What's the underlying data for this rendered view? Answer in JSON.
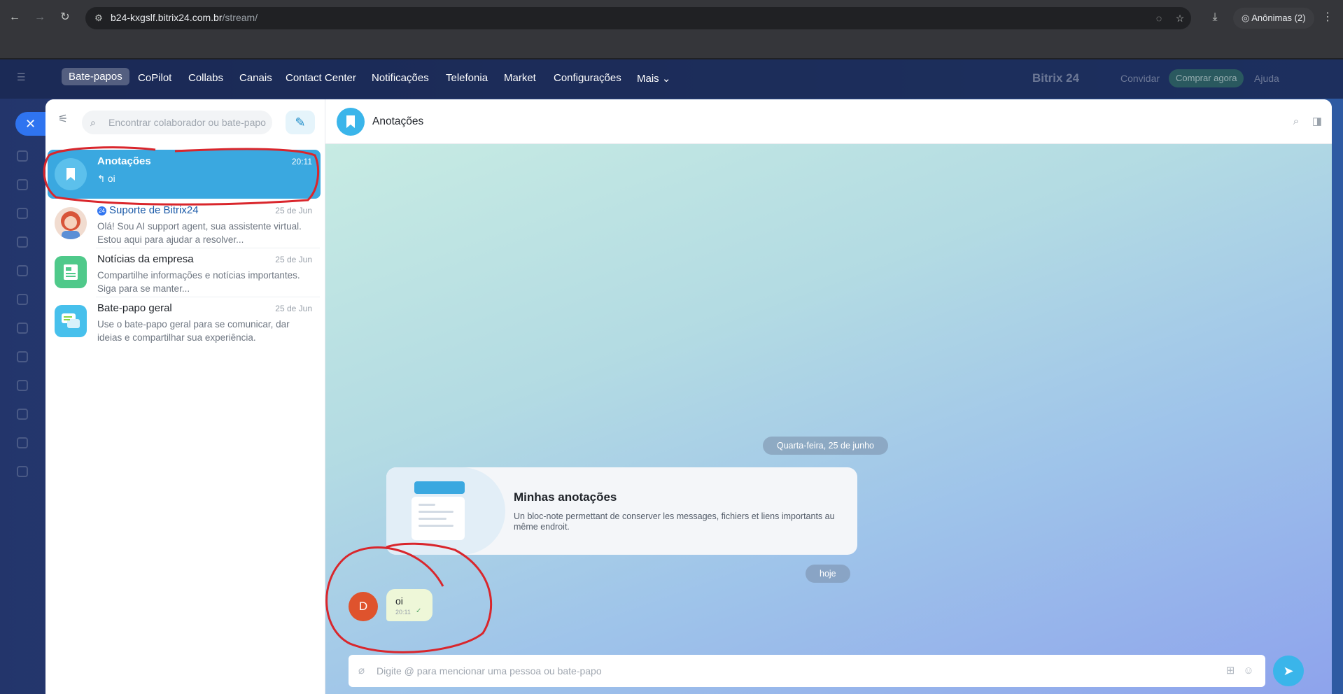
{
  "browser": {
    "url_host": "b24-kxgslf.bitrix24.com.br",
    "url_path": "/stream/",
    "incognito_label": "Anônimas (2)"
  },
  "bitrix": {
    "menu": [
      "Bate-papos",
      "CoPilot",
      "Collabs",
      "Canais",
      "Contact Center",
      "Notificações",
      "Telefonia",
      "Market",
      "Configurações",
      "Mais"
    ],
    "brand_faded": "Bitrix 24",
    "invite_faded": "Convidar",
    "buy_faded": "Comprar agora",
    "help_faded": "Ajuda"
  },
  "sidebar": {
    "search_placeholder": "Encontrar colaborador ou bate-papo",
    "chats": [
      {
        "title": "Anotações",
        "time": "20:11",
        "preview": "↰ oi",
        "active": true
      },
      {
        "title": "Suporte de Bitrix24",
        "time": "25 de Jun",
        "preview": "Olá! Sou AI support agent, sua assistente virtual. Estou aqui para ajudar a resolver..."
      },
      {
        "title": "Notícias da empresa",
        "time": "25 de Jun",
        "preview": "Compartilhe informações e notícias importantes. Siga para se manter..."
      },
      {
        "title": "Bate-papo geral",
        "time": "25 de Jun",
        "preview": "Use o bate-papo geral para se comunicar, dar ideias e compartilhar sua experiência."
      }
    ]
  },
  "chat": {
    "title": "Anotações",
    "date_divider": "Quarta-feira, 25 de junho",
    "notes_card": {
      "title": "Minhas anotações",
      "description": "Un bloc-note permettant de conserver les messages, fichiers et liens importants au même endroit."
    },
    "today_divider": "hoje",
    "message": {
      "author_initial": "D",
      "text": "oi",
      "time": "20:11"
    },
    "composer_placeholder": "Digite @ para mencionar uma pessoa ou bate-papo"
  },
  "colors": {
    "accent": "#3aa8e0",
    "annotation": "#d9262c",
    "avatar_d": "#df532d"
  }
}
